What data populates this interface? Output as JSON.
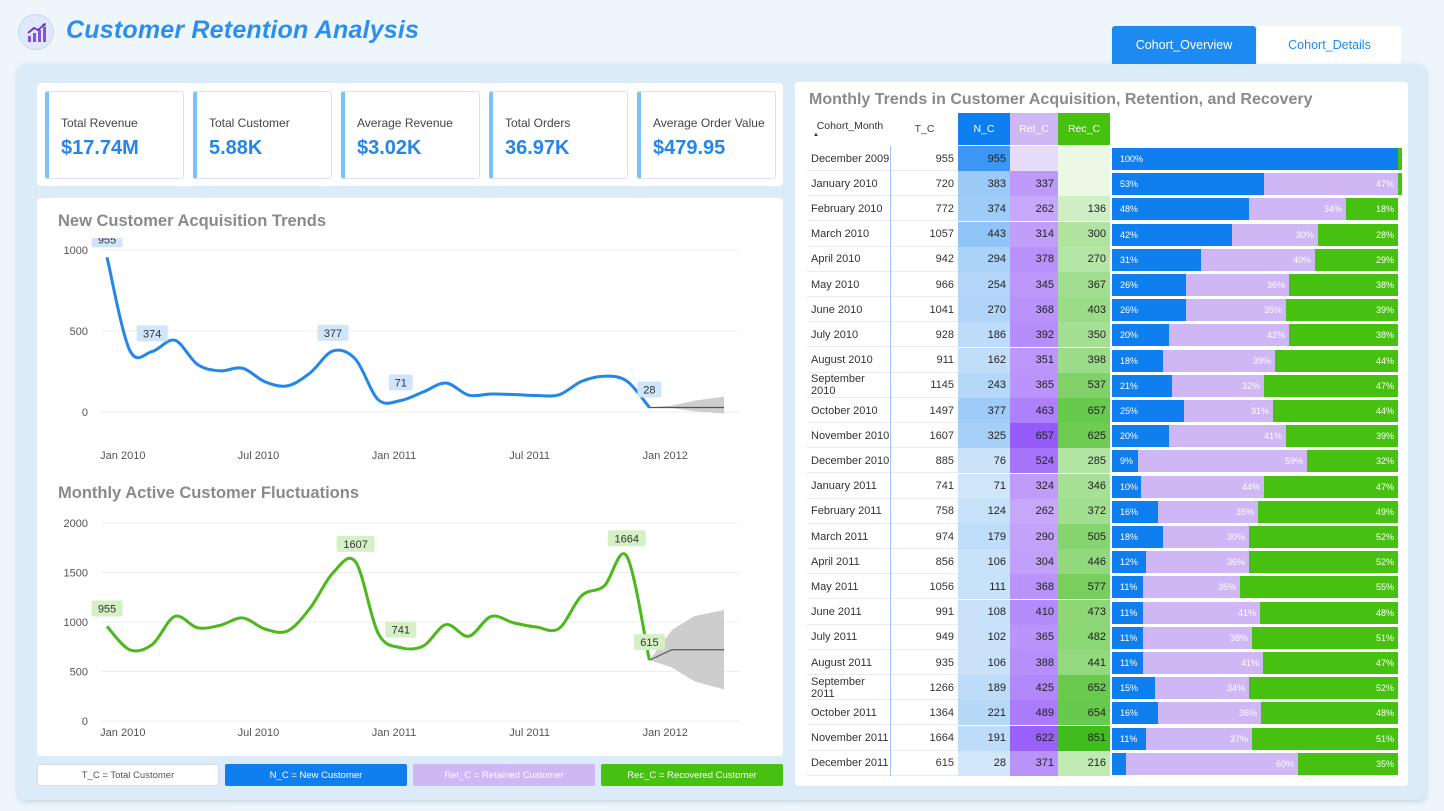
{
  "app": {
    "title": "Customer Retention Analysis",
    "logo_icon": "chart-growth-icon"
  },
  "tabs": [
    {
      "label": "Cohort_Overview",
      "active": true
    },
    {
      "label": "Cohort_Details",
      "active": false
    }
  ],
  "kpis": [
    {
      "label": "Total Revenue",
      "value": "$17.74M"
    },
    {
      "label": "Total Customer",
      "value": "5.88K"
    },
    {
      "label": "Average Revenue",
      "value": "$3.02K"
    },
    {
      "label": "Total Orders",
      "value": "36.97K"
    },
    {
      "label": "Average Order Value",
      "value": "$479.95"
    }
  ],
  "colors": {
    "accent": "#2c8ff0",
    "new": "#0f7fef",
    "retained": "#cfb6f5",
    "recovered": "#46c110"
  },
  "chart_data": [
    {
      "type": "line",
      "title": "New Customer Acquisition Trends",
      "x": [
        "Dec 2009",
        "Jan 2010",
        "Feb 2010",
        "Mar 2010",
        "Apr 2010",
        "May 2010",
        "Jun 2010",
        "Jul 2010",
        "Aug 2010",
        "Sep 2010",
        "Oct 2010",
        "Nov 2010",
        "Dec 2010",
        "Jan 2011",
        "Feb 2011",
        "Mar 2011",
        "Apr 2011",
        "May 2011",
        "Jun 2011",
        "Jul 2011",
        "Aug 2011",
        "Sep 2011",
        "Oct 2011",
        "Nov 2011",
        "Dec 2011"
      ],
      "values": [
        955,
        383,
        374,
        443,
        294,
        254,
        270,
        186,
        162,
        243,
        377,
        325,
        76,
        71,
        124,
        179,
        104,
        111,
        108,
        102,
        106,
        189,
        221,
        191,
        28
      ],
      "forecast": {
        "center": 28,
        "upper": [
          40,
          70,
          95
        ],
        "lower": [
          25,
          5,
          -10
        ]
      },
      "data_labels": [
        {
          "index": 0,
          "text": "955"
        },
        {
          "index": 2,
          "text": "374"
        },
        {
          "index": 10,
          "text": "377"
        },
        {
          "index": 13,
          "text": "71"
        },
        {
          "index": 24,
          "text": "28"
        }
      ],
      "ylim": [
        0,
        1000
      ],
      "yticks": [
        "0",
        "500",
        "1000"
      ],
      "xticks": [
        {
          "label": "Jan 2010",
          "index": 1
        },
        {
          "label": "Jul 2010",
          "index": 7
        },
        {
          "label": "Jan 2011",
          "index": 13
        },
        {
          "label": "Jul 2011",
          "index": 19
        },
        {
          "label": "Jan 2012",
          "index": 25
        }
      ],
      "color": "#2387ea",
      "label_bg": "#cfe5fb"
    },
    {
      "type": "line",
      "title": "Monthly Active Customer Fluctuations",
      "x": [
        "Dec 2009",
        "Jan 2010",
        "Feb 2010",
        "Mar 2010",
        "Apr 2010",
        "May 2010",
        "Jun 2010",
        "Jul 2010",
        "Aug 2010",
        "Sep 2010",
        "Oct 2010",
        "Nov 2010",
        "Dec 2010",
        "Jan 2011",
        "Feb 2011",
        "Mar 2011",
        "Apr 2011",
        "May 2011",
        "Jun 2011",
        "Jul 2011",
        "Aug 2011",
        "Sep 2011",
        "Oct 2011",
        "Nov 2011",
        "Dec 2011"
      ],
      "values": [
        955,
        720,
        772,
        1057,
        942,
        966,
        1041,
        928,
        911,
        1145,
        1497,
        1607,
        885,
        741,
        758,
        974,
        856,
        1056,
        991,
        949,
        935,
        1266,
        1364,
        1664,
        615
      ],
      "forecast": {
        "center": 720,
        "upper": [
          920,
          1060,
          1120
        ],
        "lower": [
          540,
          400,
          320
        ]
      },
      "data_labels": [
        {
          "index": 0,
          "text": "955"
        },
        {
          "index": 11,
          "text": "1607"
        },
        {
          "index": 13,
          "text": "741"
        },
        {
          "index": 23,
          "text": "1664"
        },
        {
          "index": 24,
          "text": "615"
        }
      ],
      "ylim": [
        0,
        2000
      ],
      "yticks": [
        "0",
        "500",
        "1000",
        "1500",
        "2000"
      ],
      "xticks": [
        {
          "label": "Jan 2010",
          "index": 1
        },
        {
          "label": "Jul 2010",
          "index": 7
        },
        {
          "label": "Jan 2011",
          "index": 13
        },
        {
          "label": "Jul 2011",
          "index": 19
        },
        {
          "label": "Jan 2012",
          "index": 25
        }
      ],
      "color": "#4cb81c",
      "label_bg": "#d6f0c6"
    }
  ],
  "legend": [
    {
      "text": "T_C = Total Customer",
      "bg": "#ffffff",
      "fg": "#555555"
    },
    {
      "text": "N_C = New Customer",
      "bg": "#0f7fef",
      "fg": "#ffffff"
    },
    {
      "text": "Ret_C = Retained Customer",
      "bg": "#cfb6f5",
      "fg": "#ffffff"
    },
    {
      "text": "Rec_C = Recovered Customer",
      "bg": "#46c110",
      "fg": "#ffffff"
    }
  ],
  "table": {
    "title": "Monthly Trends in Customer Acquisition, Retention, and Recovery",
    "headers": {
      "month": "Cohort_Month",
      "tc": "T_C",
      "nc": "N_C",
      "ret": "Ret_C",
      "rec": "Rec_C"
    },
    "rows": [
      {
        "month": "December 2009",
        "tc": "955",
        "nc": "955",
        "ret": "",
        "rec": "",
        "pn": "100%",
        "pr": "",
        "pc": "",
        "fn": 1.0,
        "fr": 0.0,
        "fc": 0.0
      },
      {
        "month": "January 2010",
        "tc": "720",
        "nc": "383",
        "ret": "337",
        "rec": "",
        "pn": "53%",
        "pr": "47%",
        "pc": "",
        "fn": 0.53,
        "fr": 0.47,
        "fc": 0.0
      },
      {
        "month": "February 2010",
        "tc": "772",
        "nc": "374",
        "ret": "262",
        "rec": "136",
        "pn": "48%",
        "pr": "34%",
        "pc": "18%",
        "fn": 0.48,
        "fr": 0.34,
        "fc": 0.18
      },
      {
        "month": "March 2010",
        "tc": "1057",
        "nc": "443",
        "ret": "314",
        "rec": "300",
        "pn": "42%",
        "pr": "30%",
        "pc": "28%",
        "fn": 0.42,
        "fr": 0.3,
        "fc": 0.28
      },
      {
        "month": "April 2010",
        "tc": "942",
        "nc": "294",
        "ret": "378",
        "rec": "270",
        "pn": "31%",
        "pr": "40%",
        "pc": "29%",
        "fn": 0.31,
        "fr": 0.4,
        "fc": 0.29
      },
      {
        "month": "May 2010",
        "tc": "966",
        "nc": "254",
        "ret": "345",
        "rec": "367",
        "pn": "26%",
        "pr": "36%",
        "pc": "38%",
        "fn": 0.26,
        "fr": 0.36,
        "fc": 0.38
      },
      {
        "month": "June 2010",
        "tc": "1041",
        "nc": "270",
        "ret": "368",
        "rec": "403",
        "pn": "26%",
        "pr": "35%",
        "pc": "39%",
        "fn": 0.26,
        "fr": 0.35,
        "fc": 0.39
      },
      {
        "month": "July 2010",
        "tc": "928",
        "nc": "186",
        "ret": "392",
        "rec": "350",
        "pn": "20%",
        "pr": "42%",
        "pc": "38%",
        "fn": 0.2,
        "fr": 0.42,
        "fc": 0.38
      },
      {
        "month": "August 2010",
        "tc": "911",
        "nc": "162",
        "ret": "351",
        "rec": "398",
        "pn": "18%",
        "pr": "39%",
        "pc": "44%",
        "fn": 0.18,
        "fr": 0.39,
        "fc": 0.43
      },
      {
        "month": "September 2010",
        "tc": "1145",
        "nc": "243",
        "ret": "365",
        "rec": "537",
        "pn": "21%",
        "pr": "32%",
        "pc": "47%",
        "fn": 0.21,
        "fr": 0.32,
        "fc": 0.47
      },
      {
        "month": "October 2010",
        "tc": "1497",
        "nc": "377",
        "ret": "463",
        "rec": "657",
        "pn": "25%",
        "pr": "31%",
        "pc": "44%",
        "fn": 0.25,
        "fr": 0.31,
        "fc": 0.44
      },
      {
        "month": "November 2010",
        "tc": "1607",
        "nc": "325",
        "ret": "657",
        "rec": "625",
        "pn": "20%",
        "pr": "41%",
        "pc": "39%",
        "fn": 0.2,
        "fr": 0.41,
        "fc": 0.39
      },
      {
        "month": "December 2010",
        "tc": "885",
        "nc": "76",
        "ret": "524",
        "rec": "285",
        "pn": "9%",
        "pr": "59%",
        "pc": "32%",
        "fn": 0.09,
        "fr": 0.59,
        "fc": 0.32
      },
      {
        "month": "January 2011",
        "tc": "741",
        "nc": "71",
        "ret": "324",
        "rec": "346",
        "pn": "10%",
        "pr": "44%",
        "pc": "47%",
        "fn": 0.1,
        "fr": 0.43,
        "fc": 0.47
      },
      {
        "month": "February 2011",
        "tc": "758",
        "nc": "124",
        "ret": "262",
        "rec": "372",
        "pn": "16%",
        "pr": "35%",
        "pc": "49%",
        "fn": 0.16,
        "fr": 0.35,
        "fc": 0.49
      },
      {
        "month": "March 2011",
        "tc": "974",
        "nc": "179",
        "ret": "290",
        "rec": "505",
        "pn": "18%",
        "pr": "30%",
        "pc": "52%",
        "fn": 0.18,
        "fr": 0.3,
        "fc": 0.52
      },
      {
        "month": "April 2011",
        "tc": "856",
        "nc": "106",
        "ret": "304",
        "rec": "446",
        "pn": "12%",
        "pr": "36%",
        "pc": "52%",
        "fn": 0.12,
        "fr": 0.36,
        "fc": 0.52
      },
      {
        "month": "May 2011",
        "tc": "1056",
        "nc": "111",
        "ret": "368",
        "rec": "577",
        "pn": "11%",
        "pr": "35%",
        "pc": "55%",
        "fn": 0.11,
        "fr": 0.34,
        "fc": 0.55
      },
      {
        "month": "June 2011",
        "tc": "991",
        "nc": "108",
        "ret": "410",
        "rec": "473",
        "pn": "11%",
        "pr": "41%",
        "pc": "48%",
        "fn": 0.11,
        "fr": 0.41,
        "fc": 0.48
      },
      {
        "month": "July 2011",
        "tc": "949",
        "nc": "102",
        "ret": "365",
        "rec": "482",
        "pn": "11%",
        "pr": "38%",
        "pc": "51%",
        "fn": 0.11,
        "fr": 0.38,
        "fc": 0.51
      },
      {
        "month": "August 2011",
        "tc": "935",
        "nc": "106",
        "ret": "388",
        "rec": "441",
        "pn": "11%",
        "pr": "41%",
        "pc": "47%",
        "fn": 0.11,
        "fr": 0.42,
        "fc": 0.47
      },
      {
        "month": "September 2011",
        "tc": "1266",
        "nc": "189",
        "ret": "425",
        "rec": "652",
        "pn": "15%",
        "pr": "34%",
        "pc": "52%",
        "fn": 0.15,
        "fr": 0.33,
        "fc": 0.52
      },
      {
        "month": "October 2011",
        "tc": "1364",
        "nc": "221",
        "ret": "489",
        "rec": "654",
        "pn": "16%",
        "pr": "36%",
        "pc": "48%",
        "fn": 0.16,
        "fr": 0.36,
        "fc": 0.48
      },
      {
        "month": "November 2011",
        "tc": "1664",
        "nc": "191",
        "ret": "622",
        "rec": "851",
        "pn": "11%",
        "pr": "37%",
        "pc": "51%",
        "fn": 0.12,
        "fr": 0.37,
        "fc": 0.51
      },
      {
        "month": "December 2011",
        "tc": "615",
        "nc": "28",
        "ret": "371",
        "rec": "216",
        "pn": "",
        "pr": "60%",
        "pc": "35%",
        "fn": 0.05,
        "fr": 0.6,
        "fc": 0.35
      }
    ]
  }
}
